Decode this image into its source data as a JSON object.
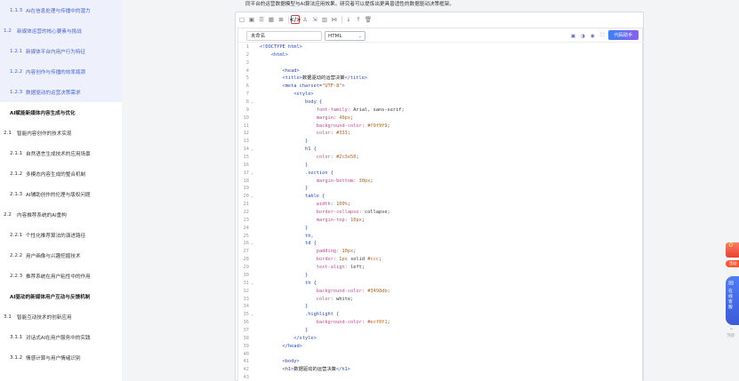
{
  "document": {
    "intro_text": "同平台的运营数据模型与AI算法应用效果。研究者可以提炼出更具普适性的数据驱动决策框架。"
  },
  "sidebar": {
    "items": [
      {
        "level": 3,
        "num": "1.1.3",
        "label": "AI在信息处理与传播中的潜力"
      },
      {
        "level": 2,
        "num": "1.2",
        "label": "新媒体运营的核心要素与挑战"
      },
      {
        "level": 3,
        "num": "1.2.1",
        "label": "新媒体平台内用户行为特征"
      },
      {
        "level": 3,
        "num": "1.2.2",
        "label": "内容创作与传播的效率瓶颈"
      },
      {
        "level": 3,
        "num": "1.2.3",
        "label": "数据驱动的运营决策需求"
      },
      {
        "level": 1,
        "num": "",
        "label": "AI赋能新媒体内容生成与优化"
      },
      {
        "level": 2,
        "num": "2.1",
        "label": "智能内容创作的技术实现"
      },
      {
        "level": 3,
        "num": "2.1.1",
        "label": "自然语言生成技术的应用场景"
      },
      {
        "level": 3,
        "num": "2.1.2",
        "label": "多模态内容生成的整合机制"
      },
      {
        "level": 3,
        "num": "2.1.3",
        "label": "AI辅助创作的伦理与版权问题"
      },
      {
        "level": 2,
        "num": "2.2",
        "label": "内容推荐系统的AI重构"
      },
      {
        "level": 3,
        "num": "2.2.1",
        "label": "个性化推荐算法的演进路径"
      },
      {
        "level": 3,
        "num": "2.2.2",
        "label": "用户画像与兴趣挖掘技术"
      },
      {
        "level": 3,
        "num": "2.2.3",
        "label": "推荐系统在用户粘性中的作用"
      },
      {
        "level": 1,
        "num": "",
        "label": "AI驱动的新媒体用户互动与反馈机制"
      },
      {
        "level": 2,
        "num": "3.1",
        "label": "智能互动技术的创新应用"
      },
      {
        "level": 3,
        "num": "3.1.1",
        "label": "对话式AI在用户服务中的实践"
      },
      {
        "level": 3,
        "num": "3.1.2",
        "label": "情感计算与用户情绪识别"
      }
    ]
  },
  "toolbar": {
    "buttons": [
      {
        "icon": "text-format-icon",
        "glyph": "□"
      },
      {
        "icon": "image-icon",
        "glyph": "▣"
      },
      {
        "icon": "list-icon",
        "glyph": "☰"
      },
      {
        "icon": "table-icon",
        "glyph": "▦"
      },
      {
        "icon": "formula-icon",
        "glyph": "⊠"
      },
      {
        "icon": "code-icon",
        "glyph": "</>"
      },
      {
        "icon": "flowchart-icon",
        "glyph": "♙"
      },
      {
        "icon": "resize-icon",
        "glyph": "⇲"
      },
      {
        "icon": "chart-icon",
        "glyph": "▥"
      },
      {
        "icon": "collapse-icon",
        "glyph": "⋈"
      },
      {
        "icon": "move-down-icon",
        "glyph": "↓"
      },
      {
        "icon": "move-up-icon",
        "glyph": "↑"
      },
      {
        "icon": "delete-icon",
        "glyph": "🗑"
      }
    ],
    "active_icon": "code-icon"
  },
  "code_panel": {
    "name_placeholder": "未命名",
    "language": "HTML",
    "assistant_label": "代码助手",
    "lines": [
      {
        "n": "1",
        "fold": "",
        "parts": [
          [
            "tag",
            "<!DOCTYPE html>"
          ]
        ]
      },
      {
        "n": "2",
        "fold": "",
        "parts": [
          [
            "tag",
            "    <html>"
          ]
        ]
      },
      {
        "n": "3",
        "fold": "",
        "parts": []
      },
      {
        "n": "4",
        "fold": "",
        "parts": [
          [
            "tag",
            "        <head>"
          ]
        ]
      },
      {
        "n": "5",
        "fold": "",
        "parts": [
          [
            "tag",
            "        <title>"
          ],
          [
            "text",
            "数据驱动的运营决策"
          ],
          [
            "tag",
            "</title>"
          ]
        ]
      },
      {
        "n": "6",
        "fold": "",
        "parts": [
          [
            "tag",
            "        <meta charset="
          ],
          [
            "str",
            "\"UTF-8\""
          ],
          [
            "tag",
            ">"
          ]
        ]
      },
      {
        "n": "7",
        "fold": "",
        "parts": [
          [
            "tag",
            "            <style>"
          ]
        ]
      },
      {
        "n": "8",
        "fold": "⌄",
        "parts": [
          [
            "sel",
            "                body {"
          ]
        ]
      },
      {
        "n": "9",
        "fold": "",
        "parts": [
          [
            "prop",
            "                    font-family: "
          ],
          [
            "val",
            "Arial, sans-serif;"
          ]
        ]
      },
      {
        "n": "10",
        "fold": "",
        "parts": [
          [
            "prop",
            "                    margin: "
          ],
          [
            "num",
            "40px"
          ],
          [
            "val",
            ";"
          ]
        ]
      },
      {
        "n": "11",
        "fold": "",
        "parts": [
          [
            "prop",
            "                    background-color: "
          ],
          [
            "col",
            "#f9f9f9"
          ],
          [
            "val",
            ";"
          ]
        ]
      },
      {
        "n": "12",
        "fold": "",
        "parts": [
          [
            "prop",
            "                    color: "
          ],
          [
            "col",
            "#333"
          ],
          [
            "val",
            ";"
          ]
        ]
      },
      {
        "n": "13",
        "fold": "",
        "parts": [
          [
            "sel",
            "                }"
          ]
        ]
      },
      {
        "n": "14",
        "fold": "⌄",
        "parts": [
          [
            "sel",
            "                h1 {"
          ]
        ]
      },
      {
        "n": "15",
        "fold": "",
        "parts": [
          [
            "prop",
            "                    color: "
          ],
          [
            "col",
            "#2c3e50"
          ],
          [
            "val",
            ";"
          ]
        ]
      },
      {
        "n": "16",
        "fold": "",
        "parts": [
          [
            "sel",
            "                }"
          ]
        ]
      },
      {
        "n": "17",
        "fold": "⌄",
        "parts": [
          [
            "sel",
            "                .section {"
          ]
        ]
      },
      {
        "n": "18",
        "fold": "",
        "parts": [
          [
            "prop",
            "                    margin-bottom: "
          ],
          [
            "num",
            "30px"
          ],
          [
            "val",
            ";"
          ]
        ]
      },
      {
        "n": "19",
        "fold": "",
        "parts": [
          [
            "sel",
            "                }"
          ]
        ]
      },
      {
        "n": "20",
        "fold": "⌄",
        "parts": [
          [
            "sel",
            "                table {"
          ]
        ]
      },
      {
        "n": "21",
        "fold": "",
        "parts": [
          [
            "prop",
            "                    width: "
          ],
          [
            "num",
            "100%"
          ],
          [
            "val",
            ";"
          ]
        ]
      },
      {
        "n": "22",
        "fold": "",
        "parts": [
          [
            "prop",
            "                    border-collapse: "
          ],
          [
            "val",
            "collapse;"
          ]
        ]
      },
      {
        "n": "23",
        "fold": "",
        "parts": [
          [
            "prop",
            "                    margin-top: "
          ],
          [
            "num",
            "10px"
          ],
          [
            "val",
            ";"
          ]
        ]
      },
      {
        "n": "24",
        "fold": "",
        "parts": [
          [
            "sel",
            "                }"
          ]
        ]
      },
      {
        "n": "25",
        "fold": "",
        "parts": [
          [
            "sel",
            "                th,"
          ]
        ]
      },
      {
        "n": "26",
        "fold": "⌄",
        "parts": [
          [
            "sel",
            "                td {"
          ]
        ]
      },
      {
        "n": "27",
        "fold": "",
        "parts": [
          [
            "prop",
            "                    padding: "
          ],
          [
            "num",
            "10px"
          ],
          [
            "val",
            ";"
          ]
        ]
      },
      {
        "n": "28",
        "fold": "",
        "parts": [
          [
            "prop",
            "                    border: "
          ],
          [
            "num",
            "1px"
          ],
          [
            "val",
            " solid "
          ],
          [
            "col",
            "#ccc"
          ],
          [
            "val",
            ";"
          ]
        ]
      },
      {
        "n": "29",
        "fold": "",
        "parts": [
          [
            "prop",
            "                    text-align: "
          ],
          [
            "val",
            "left;"
          ]
        ]
      },
      {
        "n": "30",
        "fold": "",
        "parts": [
          [
            "sel",
            "                }"
          ]
        ]
      },
      {
        "n": "31",
        "fold": "⌄",
        "parts": [
          [
            "sel",
            "                th {"
          ]
        ]
      },
      {
        "n": "32",
        "fold": "",
        "parts": [
          [
            "prop",
            "                    background-color: "
          ],
          [
            "col",
            "#3498db"
          ],
          [
            "val",
            ";"
          ]
        ]
      },
      {
        "n": "33",
        "fold": "",
        "parts": [
          [
            "prop",
            "                    color: "
          ],
          [
            "val",
            "white;"
          ]
        ]
      },
      {
        "n": "34",
        "fold": "",
        "parts": [
          [
            "sel",
            "                }"
          ]
        ]
      },
      {
        "n": "35",
        "fold": "⌄",
        "parts": [
          [
            "sel",
            "                .highlight {"
          ]
        ]
      },
      {
        "n": "36",
        "fold": "",
        "parts": [
          [
            "prop",
            "                    background-color: "
          ],
          [
            "col",
            "#ecf0f1"
          ],
          [
            "val",
            ";"
          ]
        ]
      },
      {
        "n": "37",
        "fold": "",
        "parts": [
          [
            "sel",
            "                }"
          ]
        ]
      },
      {
        "n": "38",
        "fold": "",
        "parts": [
          [
            "tag",
            "            </style>"
          ]
        ]
      },
      {
        "n": "39",
        "fold": "",
        "parts": [
          [
            "tag",
            "        </head>"
          ]
        ]
      },
      {
        "n": "40",
        "fold": "",
        "parts": []
      },
      {
        "n": "41",
        "fold": "",
        "parts": [
          [
            "tag",
            "        <body>"
          ]
        ]
      },
      {
        "n": "42",
        "fold": "",
        "parts": [
          [
            "tag",
            "        <h1>"
          ],
          [
            "text",
            "数据驱动的运营决策"
          ],
          [
            "tag",
            "</h1>"
          ]
        ]
      },
      {
        "n": "43",
        "fold": "",
        "parts": []
      }
    ]
  },
  "floating": {
    "gift_label": "活动",
    "service_label": "在线客服",
    "top_label": "顶部"
  },
  "colors": {
    "accent": "#4864cf",
    "active_border": "#d63b3b",
    "assistant_gradient_start": "#3b82f6",
    "assistant_gradient_end": "#8b5cf6"
  }
}
